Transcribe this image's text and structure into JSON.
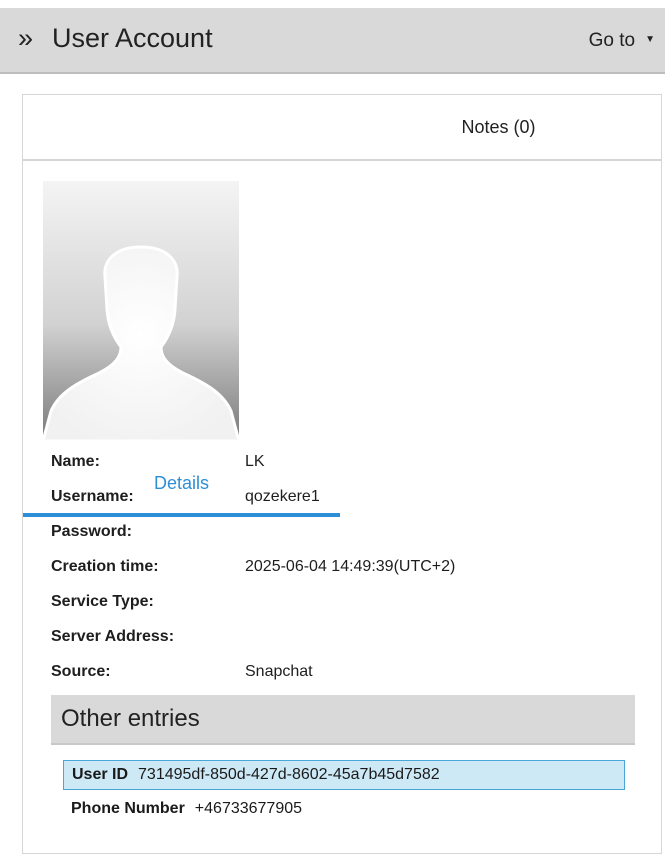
{
  "header": {
    "title": "User Account",
    "goto_label": "Go to"
  },
  "tabs": [
    {
      "label": "Details",
      "active": true
    },
    {
      "label": "Notes (0)",
      "active": false
    }
  ],
  "details": {
    "fields": [
      {
        "label": "Name:",
        "value": "LK"
      },
      {
        "label": "Username:",
        "value": "qozekere1"
      },
      {
        "label": "Password:",
        "value": ""
      },
      {
        "label": "Creation time:",
        "value": "2025-06-04 14:49:39(UTC+2)"
      },
      {
        "label": "Service Type:",
        "value": ""
      },
      {
        "label": "Server Address:",
        "value": ""
      },
      {
        "label": "Source:",
        "value": "Snapchat"
      }
    ]
  },
  "other_entries": {
    "title": "Other entries",
    "items": [
      {
        "key": "User ID",
        "value": "731495df-850d-427d-8602-45a7b45d7582",
        "selected": true
      },
      {
        "key": "Phone Number",
        "value": "+46733677905",
        "selected": false
      }
    ]
  },
  "colors": {
    "accent": "#2e8fd6",
    "header_bg": "#d9d9d9",
    "selection_bg": "#cde9f6",
    "selection_border": "#4aa6d7"
  },
  "icons": {
    "header_prefix": "double-chevron-right-icon",
    "goto_caret": "caret-down-icon",
    "avatar": "avatar-placeholder-icon"
  }
}
